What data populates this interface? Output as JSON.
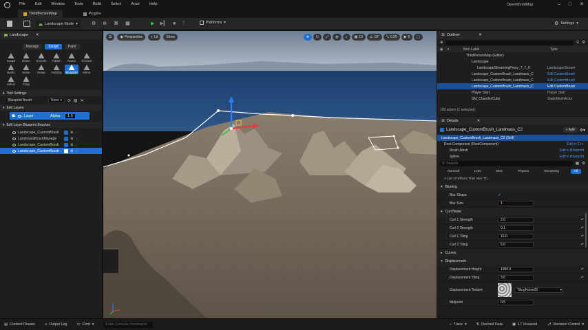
{
  "menu": [
    "File",
    "Edit",
    "Window",
    "Tools",
    "Build",
    "Select",
    "Actor",
    "Help"
  ],
  "window_title": "OpenWorldMap",
  "tabs": [
    {
      "label": "ThirdPersonMap",
      "active": true
    },
    {
      "label": "Plugins",
      "active": false
    }
  ],
  "toolbar": {
    "mode": "Landscape Mode",
    "platforms": "Platforms",
    "settings": "Settings"
  },
  "left_panel": {
    "tab_title": "Landscape",
    "modes": [
      "Manage",
      "Sculpt",
      "Paint"
    ],
    "active_mode": "Sculpt",
    "tools_row1": [
      "Sculpt",
      "Erase",
      "Smooth",
      "Flatten",
      "Ramp",
      "Erosion"
    ],
    "tools_row2": [
      "Hydro",
      "Noise",
      "Retop",
      "Visibility",
      "Blueprint",
      "Mirror"
    ],
    "tools_row3": [
      "Select",
      "Copy"
    ],
    "active_tool": "Blueprint",
    "tool_settings_header": "Tool Settings",
    "blueprint_brush_label": "Blueprint Brush",
    "blueprint_brush_value": "None",
    "edit_layers_header": "Edit Layers",
    "layer_label": "Layer",
    "alpha_label": "Alpha",
    "alpha_value": "1.0",
    "brushes_header": "Edit Layer Blueprint Brushes",
    "brushes": [
      "Landscape_CustomBrush",
      "LandmassBrushManage",
      "Landscape_CustomBrush",
      "Landscape_CustomBrush"
    ]
  },
  "viewport": {
    "perspective": "Perspective",
    "lit": "Lit",
    "show": "Show",
    "snap_grid": "10",
    "snap_angle": "10°",
    "snap_scale": "0.25",
    "camera_speed": "5"
  },
  "outliner": {
    "title": "Outliner",
    "col_label": "Item Label",
    "col_type": "Type",
    "rows": [
      {
        "label": "ThirdPersonMap (Editor)",
        "type": "",
        "indent": 1
      },
      {
        "label": "Landscape",
        "type": "",
        "indent": 2
      },
      {
        "label": "LandscapeStreamingProxy_7_7_0",
        "type": "LandscapeStream",
        "indent": 3
      },
      {
        "label": "Landscape_CustomBrush_Landmass_C",
        "type": "Edit CustomBrush",
        "indent": 2
      },
      {
        "label": "Landscape_CustomBrush_Landmass_C",
        "type": "Edit CustomBrush",
        "indent": 2
      },
      {
        "label": "Landscape_CustomBrush_Landmass_C",
        "type": "Edit CustomBrush",
        "indent": 2,
        "selected": true
      },
      {
        "label": "Player Start",
        "type": "Player Start",
        "indent": 2
      },
      {
        "label": "SM_ChamferCube",
        "type": "StaticMeshActor",
        "indent": 2
      }
    ],
    "count": "109 actors (1 selected)"
  },
  "details": {
    "title": "Details",
    "object_name": "Landscape_CustomBrush_Landmass_C2",
    "add_label": "Add",
    "self_row": "Landscape_CustomBrush_Landmass_C2 (Self)",
    "root_component": "Root Component (RootComponent)",
    "edit_cpp": "Edit in C++",
    "brush_mesh": "Brush Mesh",
    "edit_blueprint": "Edit in Blueprint",
    "spline": "Spline",
    "search_placeholder": "Search",
    "filters": [
      "General",
      "LOD",
      "Misc",
      "Physics",
      "Streaming",
      "All"
    ],
    "active_filter": "All",
    "effects_desc": "A List Of Effects That Alter Th...",
    "blurring_header": "Blurring",
    "blur_shape_label": "Blur Shape",
    "blur_size_label": "Blur Size",
    "blur_size_value": "1",
    "curl_header": "Curl Noise",
    "curl_rows": [
      {
        "label": "Curl 1 Strength",
        "value": "2.0"
      },
      {
        "label": "Curl 2 Strength",
        "value": "0.1"
      },
      {
        "label": "Curl 1 Tiling",
        "value": "16.0"
      },
      {
        "label": "Curl 2 Tiling",
        "value": "5.0"
      }
    ],
    "curves_header": "Curves",
    "displacement_header": "Displacement",
    "disp_rows": [
      {
        "label": "Displacement Height",
        "value": "1350.0"
      },
      {
        "label": "Displacement Tiling",
        "value": "3.0"
      }
    ],
    "disp_texture_label": "Displacement Texture",
    "disp_texture_value": "TilingNoise05",
    "midpoint_label": "Midpoint",
    "midpoint_value": "0.5"
  },
  "statusbar": {
    "content_drawer": "Content Drawer",
    "output_log": "Output Log",
    "cmd": "Cmd",
    "console_placeholder": "Enter Console Command",
    "trace": "Trace",
    "derived_data": "Derived Data",
    "unsaved": "17 Unsaved",
    "revision": "Revision Control"
  },
  "colors": {
    "accent": "#1f6fd4",
    "play": "#3fbf3f"
  }
}
